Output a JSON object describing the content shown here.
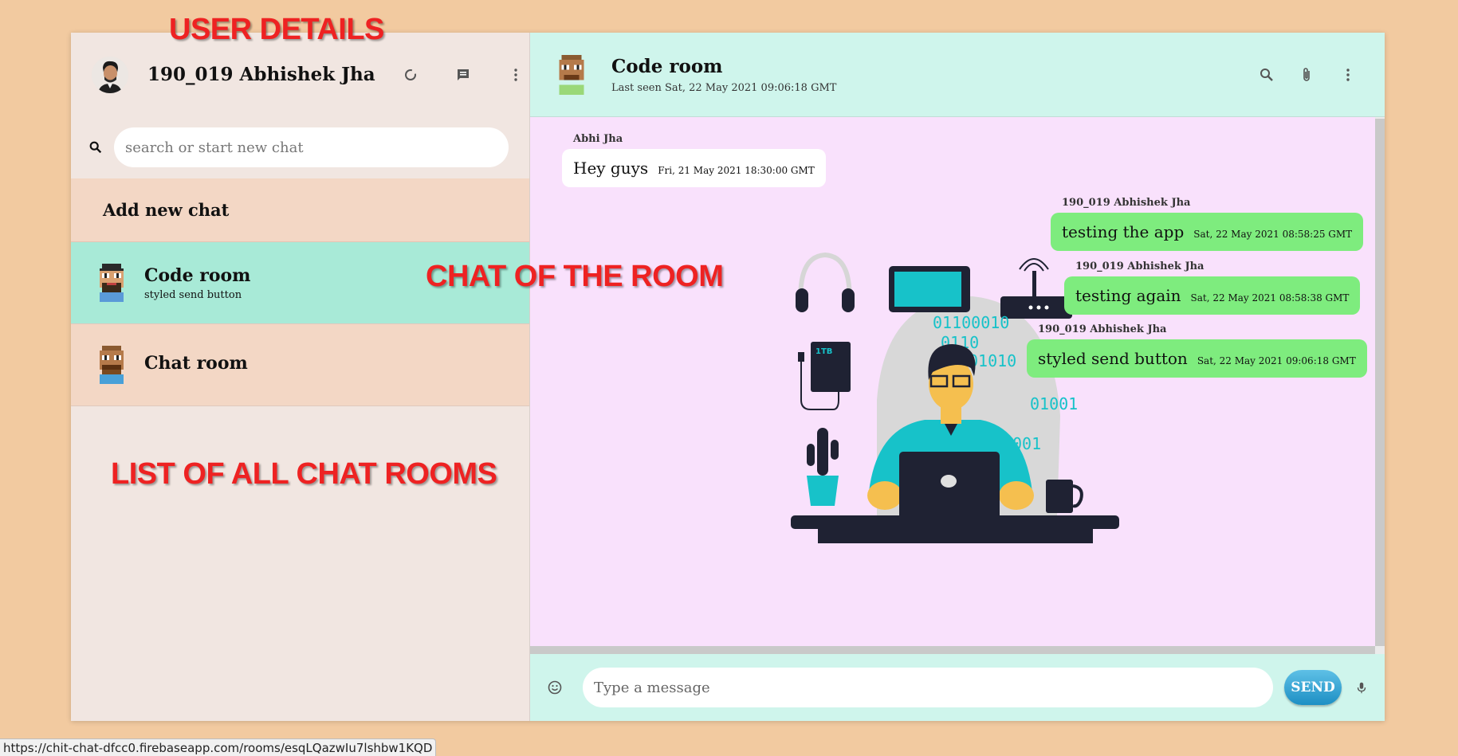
{
  "sidebar": {
    "user_name": "190_019 Abhishek Jha",
    "search_placeholder": "search or start new chat",
    "add_new_chat": "Add new chat",
    "rooms": [
      {
        "name": "Code room",
        "last_message": "styled send button"
      },
      {
        "name": "Chat room",
        "last_message": ""
      }
    ]
  },
  "chat": {
    "title": "Code room",
    "last_seen": "Last seen Sat, 22 May 2021 09:06:18 GMT",
    "messages": [
      {
        "sender": "Abhi Jha",
        "text": "Hey guys",
        "time": "Fri, 21 May 2021 18:30:00 GMT"
      },
      {
        "sender": "190_019 Abhishek Jha",
        "text": "testing the app",
        "time": "Sat, 22 May 2021 08:58:25 GMT"
      },
      {
        "sender": "190_019 Abhishek Jha",
        "text": "testing again",
        "time": "Sat, 22 May 2021 08:58:38 GMT"
      },
      {
        "sender": "190_019 Abhishek Jha",
        "text": "styled send button",
        "time": "Sat, 22 May 2021 09:06:18 GMT"
      }
    ],
    "input_placeholder": "Type a message",
    "send_label": "SEND"
  },
  "annotations": {
    "user_details": "USER DETAILS",
    "chat_of_room": "CHAT OF THE ROOM",
    "list_rooms": "LIST OF ALL CHAT ROOMS"
  },
  "illustration": {
    "storage_label": "1TB",
    "binary_lines": [
      "01100010",
      "0110",
      "01010",
      "01001",
      "001"
    ]
  },
  "status_bar": {
    "url": "https://chit-chat-dfcc0.firebaseapp.com/rooms/esqLQazwIu7lshbw1KQD"
  },
  "colors": {
    "page_bg": "#f2caa0",
    "sidebar_bg": "#f1e6e1",
    "active_room": "#a8ead7",
    "chat_header": "#cff5ec",
    "chat_bg": "#f9e1fc",
    "my_bubble": "#7eec7e",
    "annotation": "#ee2222"
  },
  "icons": [
    "refresh-icon",
    "message-icon",
    "more-vert-icon",
    "search-icon",
    "attach-icon",
    "emoji-icon",
    "mic-icon"
  ]
}
